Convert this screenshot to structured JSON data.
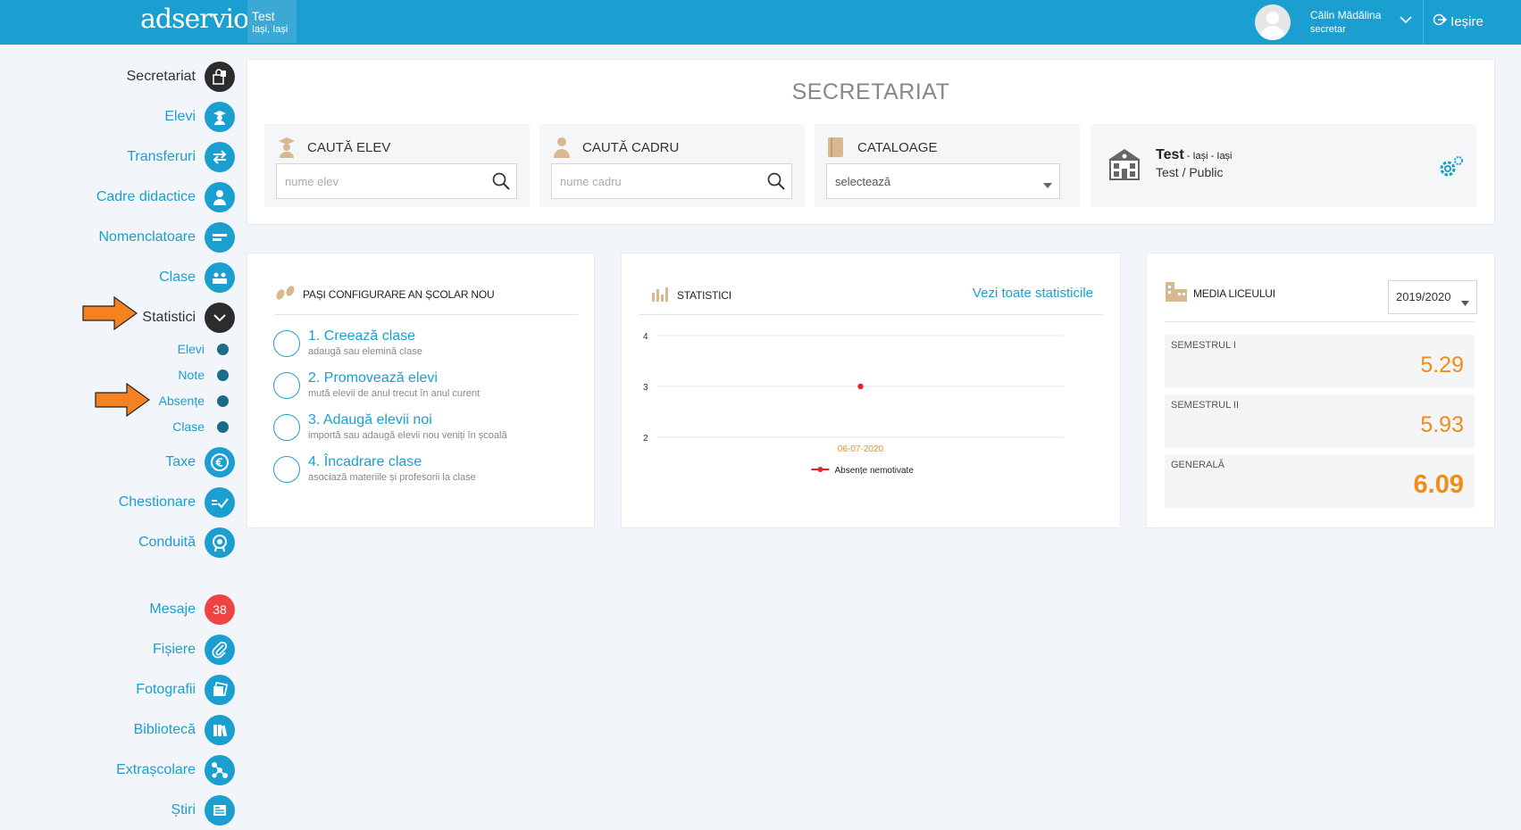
{
  "header": {
    "logo": "adservio",
    "school": {
      "name": "Test",
      "city": "Iași, Iași"
    },
    "user": {
      "name": "Călin Mădălina",
      "role": "secretar"
    },
    "logout_label": "Ieșire"
  },
  "sidebar": {
    "items": [
      {
        "label": "Secretariat",
        "icon": "lock-icon"
      },
      {
        "label": "Elevi",
        "icon": "student-icon"
      },
      {
        "label": "Transferuri",
        "icon": "transfer-icon"
      },
      {
        "label": "Cadre didactice",
        "icon": "teacher-icon"
      },
      {
        "label": "Nomenclatoare",
        "icon": "list-icon"
      },
      {
        "label": "Clase",
        "icon": "classroom-icon"
      },
      {
        "label": "Statistici",
        "icon": "chevron-down-icon"
      },
      {
        "label": "Taxe",
        "icon": "euro-icon"
      },
      {
        "label": "Chestionare",
        "icon": "checklist-icon"
      },
      {
        "label": "Conduită",
        "icon": "badge-icon"
      },
      {
        "label": "Mesaje",
        "badge": "38"
      },
      {
        "label": "Fișiere",
        "icon": "paperclip-icon"
      },
      {
        "label": "Fotografii",
        "icon": "photos-icon"
      },
      {
        "label": "Bibliotecă",
        "icon": "books-icon"
      },
      {
        "label": "Extrașcolare",
        "icon": "activities-icon"
      },
      {
        "label": "Știri",
        "icon": "news-icon"
      }
    ],
    "statistici_sub": [
      "Elevi",
      "Note",
      "Absențe",
      "Clase"
    ]
  },
  "secretariat": {
    "title": "SECRETARIAT",
    "search_elev": {
      "label": "CAUTĂ ELEV",
      "placeholder": "nume elev"
    },
    "search_cadru": {
      "label": "CAUTĂ CADRU",
      "placeholder": "nume cadru"
    },
    "cataloage": {
      "label": "CATALOAGE",
      "selected": "selectează"
    },
    "school": {
      "name": "Test",
      "location": " - Iași - Iași",
      "type": "Test / Public"
    }
  },
  "setup": {
    "title": "PAȘI CONFIGURARE AN ȘCOLAR NOU",
    "steps": [
      {
        "title": "1. Creează clase",
        "sub": "adaugă sau elemină clase"
      },
      {
        "title": "2. Promovează elevi",
        "sub": "mută elevii de anul trecut în anul curent"
      },
      {
        "title": "3. Adaugă elevii noi",
        "sub": "importă sau adaugă elevii nou veniți în școală"
      },
      {
        "title": "4. Încadrare clase",
        "sub": "asociază materiile și profesorii la clase"
      }
    ]
  },
  "stats": {
    "title": "STATISTICI",
    "link": "Vezi toate statisticile"
  },
  "chart_data": {
    "type": "line",
    "x": [
      "06-07-2020"
    ],
    "series": [
      {
        "name": "Absențe nemotivate",
        "values": [
          3
        ],
        "color": "#e8242c"
      }
    ],
    "yticks": [
      2,
      3,
      4
    ],
    "ylim": [
      2,
      4
    ],
    "grid": true,
    "legend": "bottom"
  },
  "media": {
    "title": "MEDIA LICEULUI",
    "year": "2019/2020",
    "rows": [
      {
        "label": "SEMESTRUL I",
        "value": "5.29"
      },
      {
        "label": "SEMESTRUL II",
        "value": "5.93"
      },
      {
        "label": "GENERALĂ",
        "value": "6.09"
      }
    ]
  },
  "colors": {
    "accent": "#1a9fd0",
    "orange": "#f28c17",
    "red": "#ef4444",
    "arrow": "#f58220"
  }
}
